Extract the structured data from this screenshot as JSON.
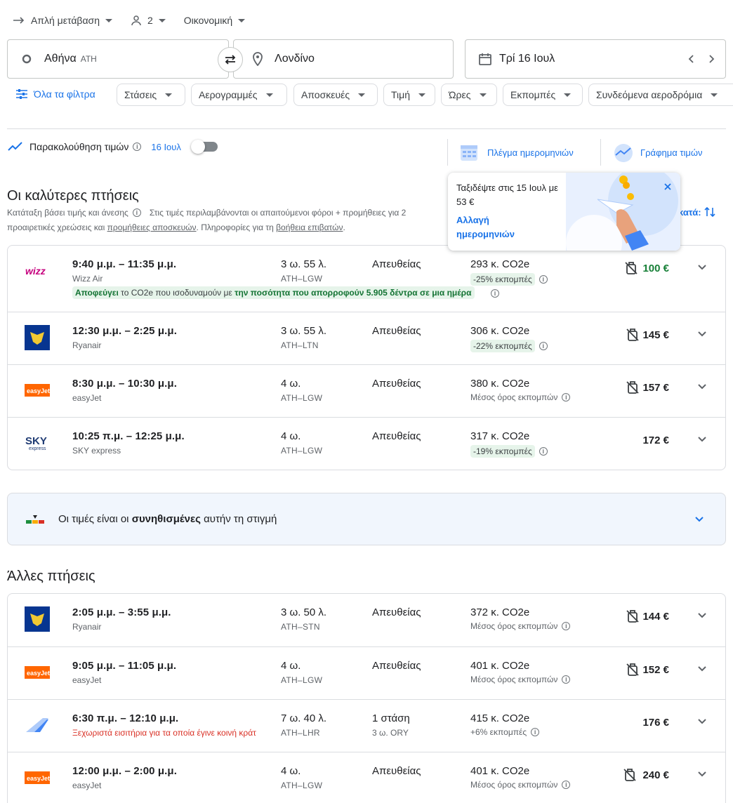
{
  "search": {
    "trip_type": "Απλή μετάβαση",
    "passengers": "2",
    "cabin": "Οικονομική",
    "origin": "Αθήνα",
    "origin_code": "ATH",
    "destination": "Λονδίνο",
    "date": "Τρί 16 Ιουλ"
  },
  "filters": {
    "all_filters": "Όλα τα φίλτρα",
    "chips": [
      "Στάσεις",
      "Αερογραμμές",
      "Αποσκευές",
      "Τιμή",
      "Ώρες",
      "Εκπομπές",
      "Συνδεόμενα αεροδρόμια"
    ]
  },
  "tracking": {
    "label": "Παρακολούθηση τιμών",
    "date": "16 Ιουλ",
    "date_grid": "Πλέγμα ημερομηνιών",
    "price_graph": "Γράφημα τιμών"
  },
  "tooltip": {
    "text": "Ταξιδέψτε στις 15 Ιουλ με 53 €",
    "link": "Αλλαγή ημερομηνιών"
  },
  "best": {
    "title": "Οι καλύτερες πτήσεις",
    "sub1": "Κατάταξη βάσει τιμής και άνεσης",
    "sub1b": "Στις τιμές περιλαμβάνονται οι απαιτούμενοι φόροι + προμήθειες για 2",
    "sub2a": "προαιρετικές χρεώσεις και ",
    "sub2link1": "προμήθειες αποσκευών",
    "sub2b": ". Πληροφορίες για τη ",
    "sub2link2": "βοήθεια επιβατών",
    "sub2c": ".",
    "sort_label": "κατά:",
    "flights": [
      {
        "time": "9:40 μ.μ. – 11:35 μ.μ.",
        "airline": "Wizz Air",
        "duration": "3 ω. 55 λ.",
        "route": "ATH–LGW",
        "stops": "Απευθείας",
        "co2": "293 κ. CO2e",
        "emissions": "-25% εκπομπές",
        "price": "100 €",
        "logo": "wizz"
      },
      {
        "time": "12:30 μ.μ. – 2:25 μ.μ.",
        "airline": "Ryanair",
        "duration": "3 ω. 55 λ.",
        "route": "ATH–LTN",
        "stops": "Απευθείας",
        "co2": "306 κ. CO2e",
        "emissions": "-22% εκπομπές",
        "price": "145 €",
        "logo": "ryanair"
      },
      {
        "time": "8:30 μ.μ. – 10:30 μ.μ.",
        "airline": "easyJet",
        "duration": "4 ω.",
        "route": "ATH–LGW",
        "stops": "Απευθείας",
        "co2": "380 κ. CO2e",
        "emissions": "Μέσος όρος εκπομπών",
        "price": "157 €",
        "logo": "easyjet"
      },
      {
        "time": "10:25 π.μ. – 12:25 μ.μ.",
        "airline": "SKY express",
        "duration": "4 ω.",
        "route": "ATH–LGW",
        "stops": "Απευθείας",
        "co2": "317 κ. CO2e",
        "emissions": "-19% εκπομπές",
        "price": "172 €",
        "logo": "sky"
      }
    ],
    "wizz_note_a": "Αποφεύγει",
    "wizz_note_b": " το CO2e που ισοδυναμούν με ",
    "wizz_note_c": "την ποσότητα που απορροφούν 5.905 δέντρα σε μια ημέρα"
  },
  "price_insight": {
    "a": "Οι τιμές είναι οι ",
    "b": "συνηθισμένες",
    "c": " αυτήν τη στιγμή"
  },
  "other": {
    "title": "Άλλες πτήσεις",
    "flights": [
      {
        "time": "2:05 μ.μ. – 3:55 μ.μ.",
        "airline": "Ryanair",
        "duration": "3 ω. 50 λ.",
        "route": "ATH–STN",
        "stops": "Απευθείας",
        "co2": "372 κ. CO2e",
        "emissions": "Μέσος όρος εκπομπών",
        "price": "144 €",
        "logo": "ryanair"
      },
      {
        "time": "9:05 μ.μ. – 11:05 μ.μ.",
        "airline": "easyJet",
        "duration": "4 ω.",
        "route": "ATH–LGW",
        "stops": "Απευθείας",
        "co2": "401 κ. CO2e",
        "emissions": "Μέσος όρος εκπομπών",
        "price": "152 €",
        "logo": "easyjet"
      },
      {
        "time": "6:30 π.μ. – 12:10 μ.μ.",
        "airline": "Ξεχωριστά εισιτήρια για τα οποία έγινε κοινή κράτ",
        "duration": "7 ω. 40 λ.",
        "route": "ATH–LHR",
        "stops": "1 στάση",
        "stop_detail": "3 ω. ORY",
        "co2": "415 κ. CO2e",
        "emissions": "+6% εκπομπές",
        "price": "176 €",
        "logo": "multi"
      },
      {
        "time": "12:00 μ.μ. – 2:00 μ.μ.",
        "airline": "easyJet",
        "duration": "4 ω.",
        "route": "ATH–LGW",
        "stops": "Απευθείας",
        "co2": "401 κ. CO2e",
        "emissions": "Μέσος όρος εκπομπών",
        "price": "240 €",
        "logo": "easyjet"
      }
    ]
  },
  "colors": {
    "accent": "#1a73e8",
    "green_price": "#188038",
    "badge": "#e6f4ea",
    "red": "#d93025"
  }
}
